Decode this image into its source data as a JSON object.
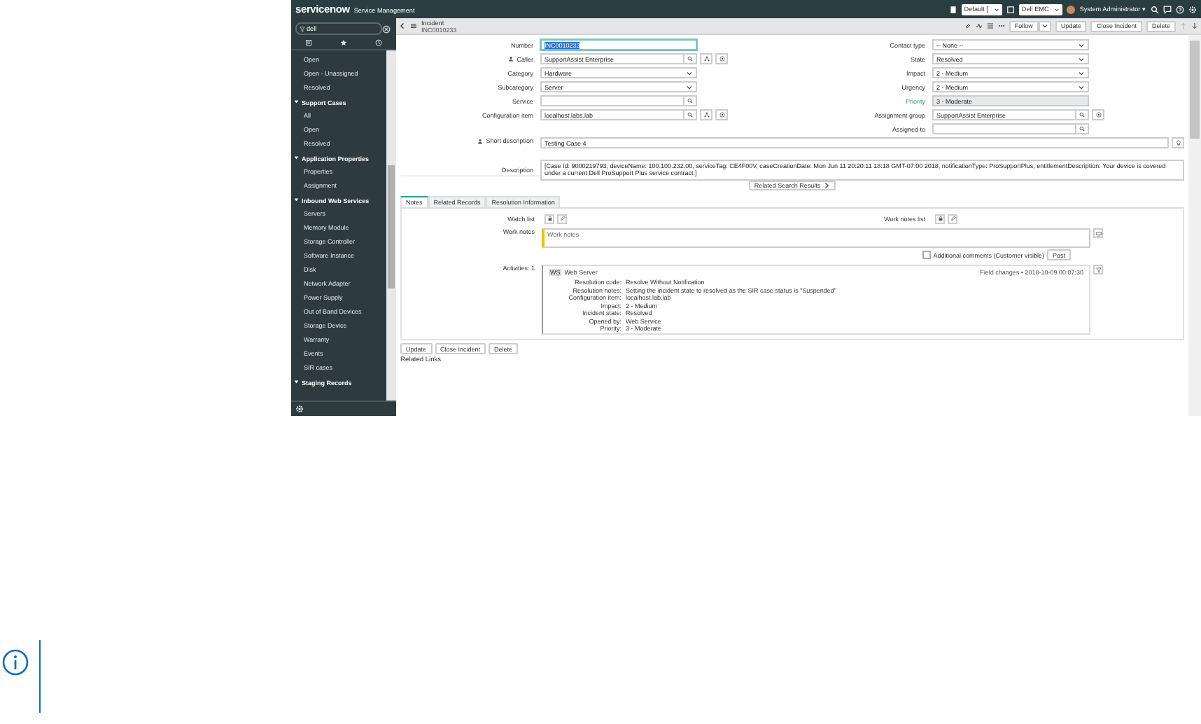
{
  "header": {
    "brand": "servicenow",
    "product": "Service Management",
    "update_set": "Default [",
    "domain": "Dell EMC",
    "user": "System Administrator ▾"
  },
  "sidebar": {
    "filter": "dell",
    "items": [
      {
        "label": "Open",
        "kind": "module"
      },
      {
        "label": "Open - Unassigned",
        "kind": "module"
      },
      {
        "label": "Resolved",
        "kind": "module"
      },
      {
        "label": "Support Cases",
        "kind": "section",
        "expanded": true,
        "children": [
          {
            "label": "All"
          },
          {
            "label": "Open"
          },
          {
            "label": "Resolved"
          }
        ]
      },
      {
        "label": "Application Properties",
        "kind": "section",
        "expanded": true,
        "children": [
          {
            "label": "Properties"
          },
          {
            "label": "Assignment"
          }
        ]
      },
      {
        "label": "Inbound Web Services",
        "kind": "section",
        "expanded": true,
        "children": [
          {
            "label": "Servers"
          },
          {
            "label": "Memory Module"
          },
          {
            "label": "Storage Controller"
          },
          {
            "label": "Software Instance"
          },
          {
            "label": "Disk"
          },
          {
            "label": "Network Adapter"
          },
          {
            "label": "Power Supply"
          },
          {
            "label": "Out of Band Devices"
          },
          {
            "label": "Storage Device"
          },
          {
            "label": "Warranty"
          },
          {
            "label": "Events"
          },
          {
            "label": "SIR cases"
          }
        ]
      },
      {
        "label": "Staging Records",
        "kind": "section",
        "expanded": true
      }
    ]
  },
  "record": {
    "table": "Incident",
    "number": "INC0010233",
    "actions": [
      "Follow",
      "Update",
      "Close Incident",
      "Delete"
    ]
  },
  "form": {
    "left": [
      {
        "label": "Number",
        "value": "INC0010233",
        "kind": "text",
        "highlighted": true
      },
      {
        "label": "Caller",
        "value": "SupportAssist Enterprise",
        "kind": "reference_full",
        "flagged": true
      },
      {
        "label": "Category",
        "value": "Hardware",
        "kind": "select"
      },
      {
        "label": "Subcategory",
        "value": "Server",
        "kind": "select"
      },
      {
        "label": "Service",
        "kind": "lookup"
      },
      {
        "label": "Configuration item",
        "value": "localhost.labs.lab",
        "kind": "reference_full"
      }
    ],
    "right": [
      {
        "label": "Contact type",
        "value": "-- None --",
        "kind": "select"
      },
      {
        "label": "State",
        "value": "Resolved",
        "kind": "select"
      },
      {
        "label": "Impact",
        "value": "2 - Medium",
        "kind": "select"
      },
      {
        "label": "Urgency",
        "value": "2 - Medium",
        "kind": "select"
      },
      {
        "label": "Priority",
        "value": "3 - Moderate",
        "kind": "readonly"
      },
      {
        "label": "Assignment group",
        "value": "SupportAssist Enterprise",
        "kind": "reference"
      },
      {
        "label": "Assigned to",
        "kind": "lookup"
      }
    ],
    "short_description": {
      "label": "Short description",
      "value": "Testing Case 4"
    },
    "description": {
      "label": "Description",
      "value": "[Case Id: 9000219793, deviceName: 100.100.232.00, serviceTag: CE4F00V, caseCreationDate: Mon Jun 11 20:20:11 18:18 GMT-07:00 2018, notificationType: ProSupportPlus, entitlementDescription: Your device is covered under a current Dell ProSupport Plus service contract.]"
    },
    "related_search": "Related Search Results"
  },
  "tabs": [
    {
      "label": "Notes",
      "selected": true
    },
    {
      "label": "Related Records",
      "selected": false
    },
    {
      "label": "Resolution Information",
      "selected": false
    }
  ],
  "notes": {
    "watch_list": "Watch list",
    "work_notes_list": "Work notes list",
    "work_notes_label": "Work notes",
    "work_notes_placeholder": "Work notes",
    "additional_comments": {
      "label": "Additional comments (Customer visible)",
      "checked": false
    },
    "post": "Post",
    "activities": "Activities: 1",
    "activity": {
      "avatar": "WS",
      "author": "Web Server",
      "meta": "Field changes • 2018-10-09 00:07:30",
      "rows": [
        {
          "key": "Resolution code:",
          "value": "Resolve Without Notification"
        },
        {
          "key": "Resolution notes:",
          "value": "Setting the incident state to resolved as the SIR case status is \"Suspended\""
        },
        {
          "key": "Configuration item:",
          "value": "localhost.lab.lab"
        },
        {
          "key": "Impact:",
          "value": "2 - Medium"
        },
        {
          "key": "Incident state:",
          "value": "Resolved"
        },
        {
          "key": "Opened by:",
          "value": "Web Service"
        },
        {
          "key": "Priority:",
          "value": "3 - Moderate"
        }
      ]
    }
  },
  "bottom_buttons": [
    "Update",
    "Close Incident",
    "Delete"
  ],
  "related_links": "Related Links"
}
